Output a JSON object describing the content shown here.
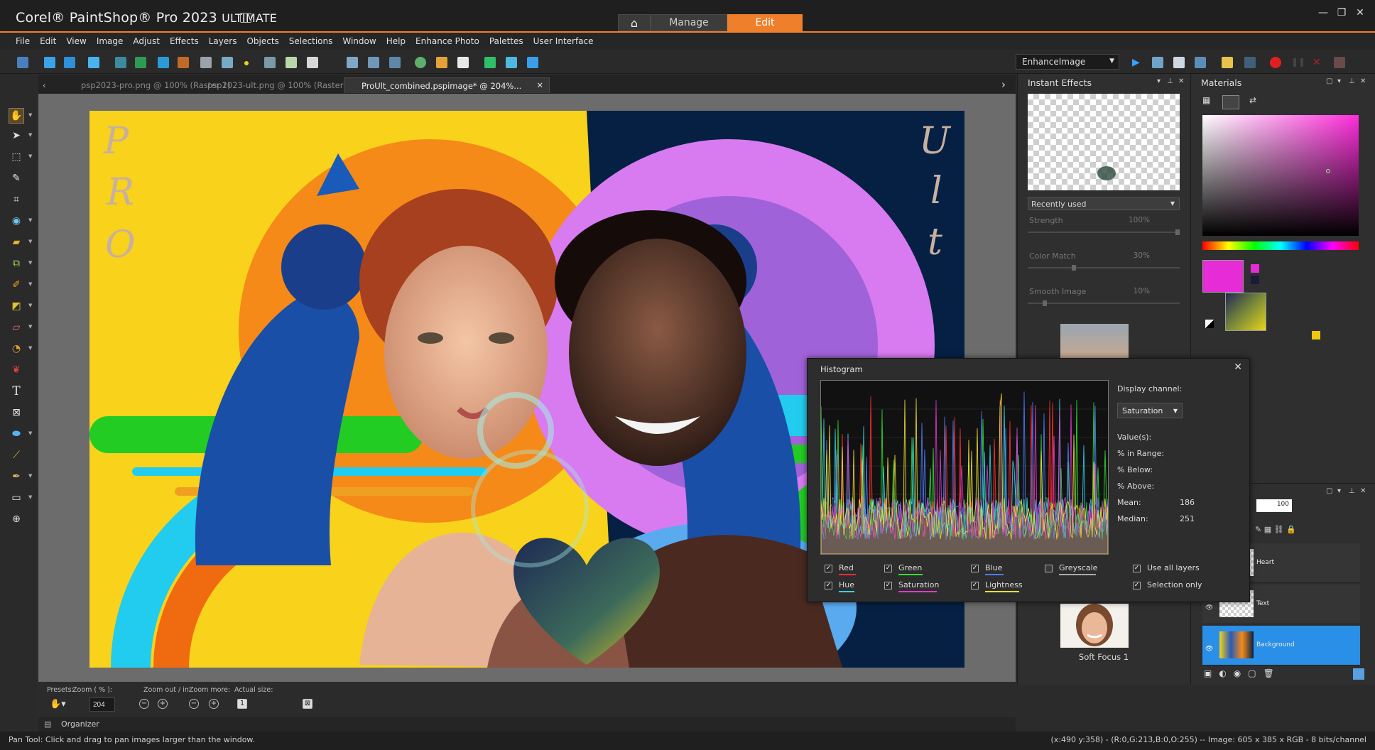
{
  "app": {
    "title_main": "Corel® PaintShop® Pro 2023",
    "title_suffix": "ULTIMATE",
    "workspace_tabs": {
      "manage": "Manage",
      "edit": "Edit"
    },
    "window_controls": {
      "minimize": "—",
      "restore": "❐",
      "close": "✕"
    }
  },
  "menu": [
    "File",
    "Edit",
    "View",
    "Image",
    "Adjust",
    "Effects",
    "Layers",
    "Objects",
    "Selections",
    "Window",
    "Help",
    "Enhance Photo",
    "Palettes",
    "User Interface"
  ],
  "script": {
    "selected": "EnhanceImage"
  },
  "document_tabs": [
    {
      "label": "psp2023-pro.png @ 100% (Raster 1)"
    },
    {
      "label": "psp2023-ult.png @ 100% (Raster 1)"
    },
    {
      "label": "ProUlt_combined.pspimage* @ 204%..."
    }
  ],
  "canvas_text": {
    "left_letters": [
      "P",
      "R",
      "O"
    ],
    "right_letters": [
      "U",
      "l",
      "t"
    ]
  },
  "instant_effects": {
    "title": "Instant Effects",
    "category": "Recently used",
    "sliders": [
      {
        "label": "Strength",
        "value": "100%",
        "fraction": 1.0
      },
      {
        "label": "Color Match",
        "value": "30%",
        "fraction": 0.3
      },
      {
        "label": "Smooth Image",
        "value": "10%",
        "fraction": 0.1
      }
    ],
    "bottom_effect": "Soft Focus 1"
  },
  "materials": {
    "title": "Materials",
    "fg_color": "#e62cd6"
  },
  "layers": {
    "opacity": "100",
    "items": [
      {
        "name": "Heart",
        "selected": false
      },
      {
        "name": "Text",
        "selected": false
      },
      {
        "name": "Background",
        "selected": true
      }
    ]
  },
  "histogram": {
    "title": "Histogram",
    "display_channel_label": "Display channel:",
    "channel": "Saturation",
    "stats": [
      {
        "label": "Value(s):",
        "value": ""
      },
      {
        "label": "% in Range:",
        "value": ""
      },
      {
        "label": "% Below:",
        "value": ""
      },
      {
        "label": "% Above:",
        "value": ""
      },
      {
        "label": "Mean:",
        "value": "186"
      },
      {
        "label": "Median:",
        "value": "251"
      }
    ],
    "channels": [
      {
        "label": "Red",
        "checked": true,
        "color": "#ff3030"
      },
      {
        "label": "Green",
        "checked": true,
        "color": "#30e030"
      },
      {
        "label": "Blue",
        "checked": true,
        "color": "#4f7dff"
      },
      {
        "label": "Greyscale",
        "checked": false,
        "color": "#aaaaaa"
      },
      {
        "label": "Hue",
        "checked": true,
        "color": "#2fd5e8"
      },
      {
        "label": "Saturation",
        "checked": true,
        "color": "#e03ad0"
      },
      {
        "label": "Lightness",
        "checked": true,
        "color": "#f0e030"
      }
    ],
    "options": [
      {
        "label": "Use all layers",
        "checked": true
      },
      {
        "label": "Selection only",
        "checked": true
      }
    ]
  },
  "presets_bar": {
    "presets": "Presets:",
    "zoom_label": "Zoom ( % ):",
    "zoom_value": "204",
    "zoom_out_in": "Zoom out / in:",
    "zoom_more": "Zoom more:",
    "actual_size": "Actual size:"
  },
  "organizer": "Organizer",
  "status": {
    "left": "Pan Tool: Click and drag to pan images larger than the window.",
    "right": "(x:490 y:358) - (R:0,G:213,B:0,O:255) -- Image:  605 x 385 x RGB - 8 bits/channel"
  }
}
